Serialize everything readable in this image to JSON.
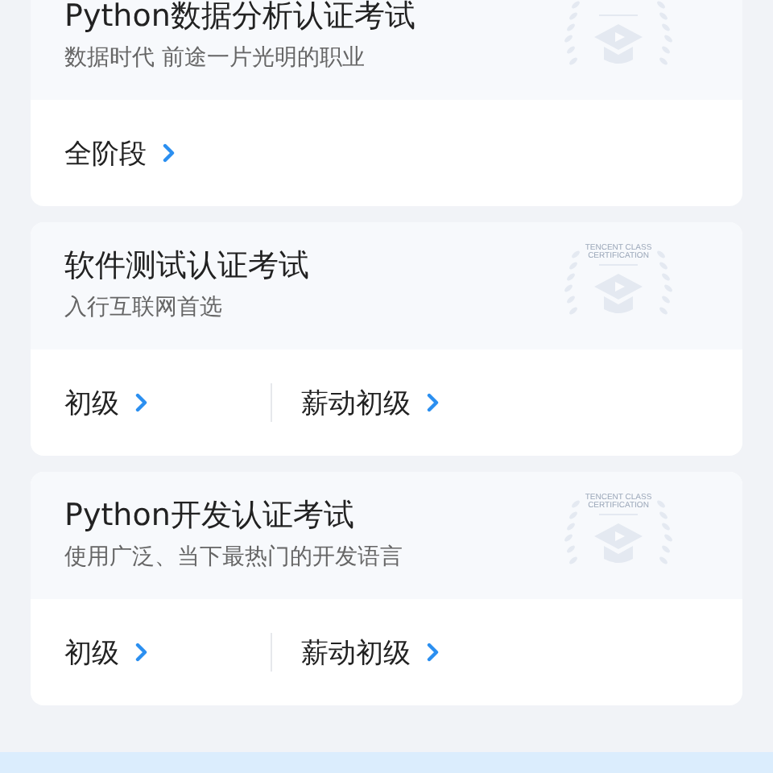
{
  "courses": [
    {
      "title": "Python数据分析认证考试",
      "subtitle": "数据时代 前途一片光明的职业",
      "levels": [
        {
          "label": "全阶段"
        }
      ]
    },
    {
      "title": "软件测试认证考试",
      "subtitle": "入行互联网首选",
      "badge_lines": [
        "TENCENT CLASS",
        "CERTIFICATION"
      ],
      "levels": [
        {
          "label": "初级"
        },
        {
          "label": "薪动初级"
        }
      ]
    },
    {
      "title": "Python开发认证考试",
      "subtitle": "使用广泛、当下最热门的开发语言",
      "badge_lines": [
        "TENCENT CLASS",
        "CERTIFICATION"
      ],
      "levels": [
        {
          "label": "初级"
        },
        {
          "label": "薪动初级"
        }
      ]
    }
  ]
}
